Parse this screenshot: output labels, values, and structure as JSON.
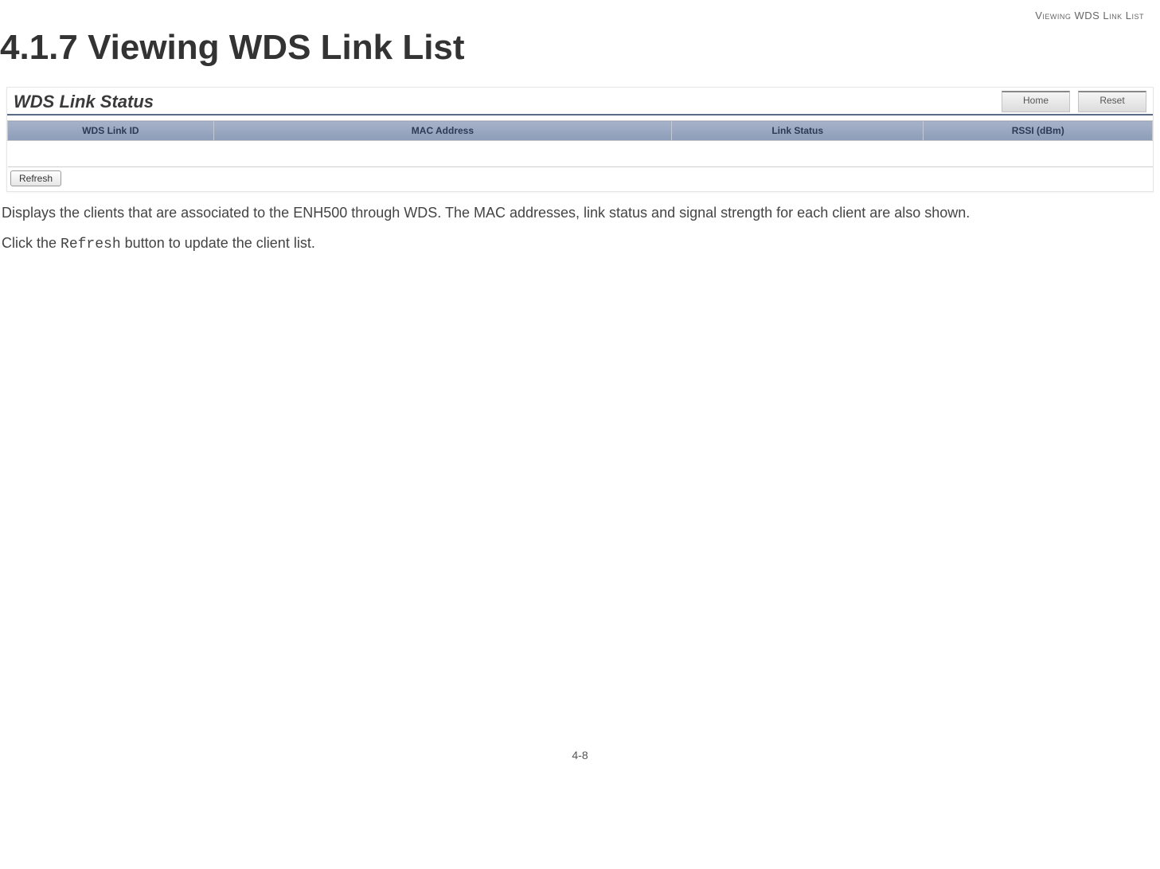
{
  "header_small": "Viewing WDS Link List",
  "section_heading": "4.1.7 Viewing WDS Link List",
  "screenshot": {
    "title": "WDS Link Status",
    "home_btn": "Home",
    "reset_btn": "Reset",
    "columns": {
      "id": "WDS Link ID",
      "mac": "MAC Address",
      "status": "Link Status",
      "rssi": "RSSI (dBm)"
    },
    "refresh_btn": "Refresh"
  },
  "paragraph1": "Displays the clients that are associated to the ENH500 through WDS. The MAC addresses, link status and signal strength for each client are also shown.",
  "paragraph2_prefix": "Click the ",
  "paragraph2_mono": "Refresh",
  "paragraph2_suffix": " button to update the client list.",
  "footer": "4-8"
}
